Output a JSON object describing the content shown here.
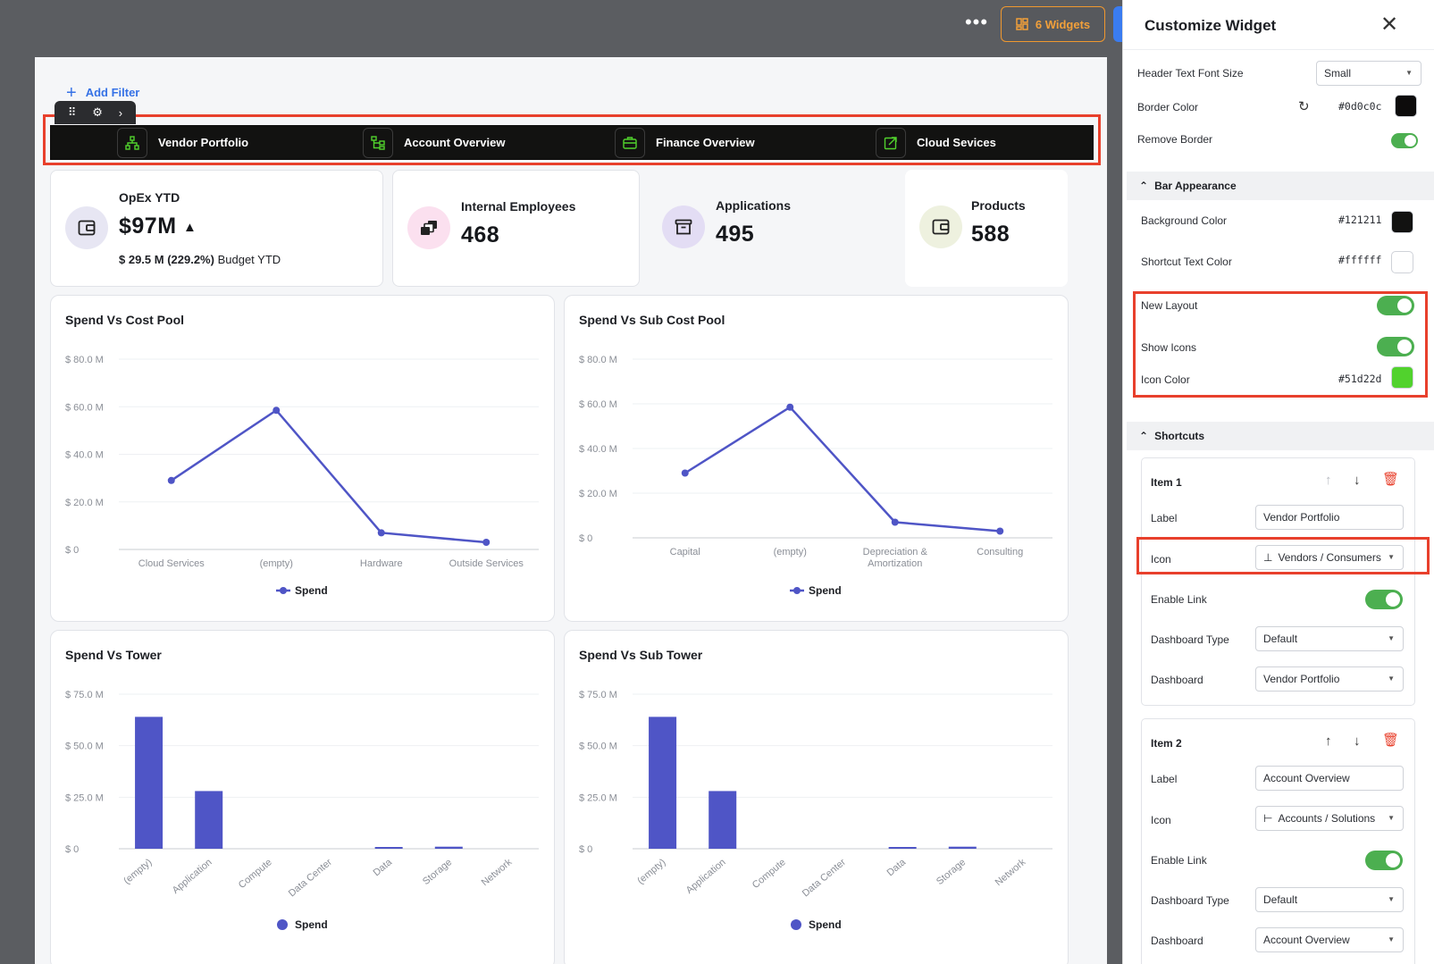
{
  "topbar": {
    "more_label": "•••",
    "widgets_label": "6 Widgets"
  },
  "canvas": {
    "add_filter_label": "Add Filter",
    "shortcuts": [
      {
        "label": "Vendor Portfolio",
        "icon": "vendors-hierarchy-icon"
      },
      {
        "label": "Account Overview",
        "icon": "accounts-solutions-icon"
      },
      {
        "label": "Finance Overview",
        "icon": "briefcase-icon"
      },
      {
        "label": "Cloud Sevices",
        "icon": "external-link-icon"
      }
    ],
    "kpis": [
      {
        "label": "OpEx YTD",
        "value": "$97M",
        "trend": "▲",
        "sub_bold": "$ 29.5 M (229.2%)",
        "sub_text": "Budget YTD",
        "icon": "wallet-icon",
        "icon_bg": "#e7e6f3"
      },
      {
        "label": "Internal Employees",
        "value": "468",
        "icon": "stack-icon",
        "icon_bg": "#fbe0ef"
      },
      {
        "label": "Applications",
        "value": "495",
        "icon": "archive-icon",
        "icon_bg": "#e3ddf4"
      },
      {
        "label": "Products",
        "value": "588",
        "icon": "wallet-icon",
        "icon_bg": "#eef1df"
      }
    ],
    "charts": [
      {
        "title": "Spend Vs Cost Pool",
        "chart_data": {
          "type": "line",
          "categories": [
            "Cloud Services",
            "(empty)",
            "Hardware",
            "Outside Services"
          ],
          "series": [
            {
              "name": "Spend",
              "values": [
                29,
                58.5,
                7,
                3
              ]
            }
          ],
          "yticks": [
            "$ 0",
            "$ 20.0 M",
            "$ 40.0 M",
            "$ 60.0 M",
            "$ 80.0 M"
          ],
          "ylim": [
            0,
            80
          ],
          "legend": "bottom",
          "color": "#4f55c6"
        }
      },
      {
        "title": "Spend Vs Sub Cost Pool",
        "chart_data": {
          "type": "line",
          "categories": [
            "Capital",
            "(empty)",
            "Depreciation & Amortization",
            "Consulting"
          ],
          "series": [
            {
              "name": "Spend",
              "values": [
                29,
                58.5,
                7,
                3
              ]
            }
          ],
          "yticks": [
            "$ 0",
            "$ 20.0 M",
            "$ 40.0 M",
            "$ 60.0 M",
            "$ 80.0 M"
          ],
          "ylim": [
            0,
            80
          ],
          "legend": "bottom",
          "color": "#4f55c6"
        }
      },
      {
        "title": "Spend Vs Tower",
        "chart_data": {
          "type": "bar",
          "categories": [
            "(empty)",
            "Application",
            "Compute",
            "Data Center",
            "Data",
            "Storage",
            "Network"
          ],
          "series": [
            {
              "name": "Spend",
              "values": [
                64,
                28,
                0,
                0,
                0.6,
                1.0,
                0
              ]
            }
          ],
          "yticks": [
            "$ 0",
            "$ 25.0 M",
            "$ 50.0 M",
            "$ 75.0 M"
          ],
          "ylim": [
            0,
            75
          ],
          "legend": "bottom",
          "color": "#4f55c6"
        }
      },
      {
        "title": "Spend Vs Sub Tower",
        "chart_data": {
          "type": "bar",
          "categories": [
            "(empty)",
            "Application",
            "Compute",
            "Data Center",
            "Data",
            "Storage",
            "Network"
          ],
          "series": [
            {
              "name": "Spend",
              "values": [
                64,
                28,
                0,
                0,
                0.6,
                1.0,
                0
              ]
            }
          ],
          "yticks": [
            "$ 0",
            "$ 25.0 M",
            "$ 50.0 M",
            "$ 75.0 M"
          ],
          "ylim": [
            0,
            75
          ],
          "legend": "bottom",
          "color": "#4f55c6"
        }
      }
    ]
  },
  "panel": {
    "title": "Customize Widget",
    "header_font_size_label": "Header Text Font Size",
    "header_font_size_value": "Small",
    "border_color_label": "Border Color",
    "border_color_value": "#0d0c0c",
    "remove_border_label": "Remove Border",
    "bar_appearance_label": "Bar Appearance",
    "bg_color_label": "Background Color",
    "bg_color_value": "#121211",
    "shortcut_text_color_label": "Shortcut Text Color",
    "shortcut_text_color_value": "#ffffff",
    "new_layout_label": "New Layout",
    "show_icons_label": "Show Icons",
    "icon_color_label": "Icon Color",
    "icon_color_value": "#51d22d",
    "shortcuts_section_label": "Shortcuts",
    "items": [
      {
        "title": "Item 1",
        "label_label": "Label",
        "label_value": "Vendor Portfolio",
        "icon_label": "Icon",
        "icon_value": "Vendors / Consumers",
        "enable_link_label": "Enable Link",
        "dashboard_type_label": "Dashboard Type",
        "dashboard_type_value": "Default",
        "dashboard_label": "Dashboard",
        "dashboard_value": "Vendor Portfolio"
      },
      {
        "title": "Item 2",
        "label_label": "Label",
        "label_value": "Account Overview",
        "icon_label": "Icon",
        "icon_value": "Accounts / Solutions",
        "enable_link_label": "Enable Link",
        "dashboard_type_label": "Dashboard Type",
        "dashboard_type_value": "Default",
        "dashboard_label": "Dashboard",
        "dashboard_value": "Account Overview"
      }
    ]
  }
}
